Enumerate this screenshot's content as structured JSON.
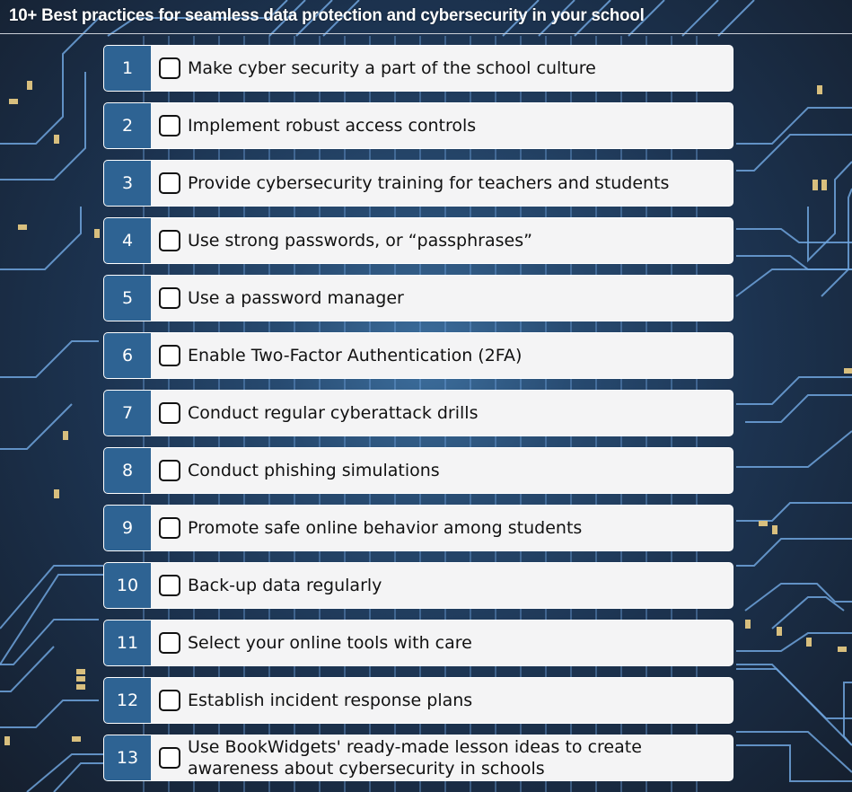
{
  "header": {
    "title": "10+ Best practices for seamless data protection and cybersecurity in your school"
  },
  "theme": {
    "number_badge_color": "#2e6393",
    "item_background": "#f4f4f5",
    "circuit_line_color": "#6fa3dc",
    "circuit_pad_color": "#d8bf7e"
  },
  "checklist": {
    "items": [
      {
        "number": "1",
        "label": "Make cyber security a part of the school culture",
        "checked": false
      },
      {
        "number": "2",
        "label": "Implement robust access controls",
        "checked": false
      },
      {
        "number": "3",
        "label": "Provide cybersecurity training for teachers and students",
        "checked": false
      },
      {
        "number": "4",
        "label": "Use strong passwords, or “passphrases”",
        "checked": false
      },
      {
        "number": "5",
        "label": "Use a password manager",
        "checked": false
      },
      {
        "number": "6",
        "label": "Enable Two-Factor Authentication (2FA)",
        "checked": false
      },
      {
        "number": "7",
        "label": "Conduct regular cyberattack drills",
        "checked": false
      },
      {
        "number": "8",
        "label": "Conduct phishing simulations",
        "checked": false
      },
      {
        "number": "9",
        "label": "Promote safe online behavior among students",
        "checked": false
      },
      {
        "number": "10",
        "label": "Back-up data regularly",
        "checked": false
      },
      {
        "number": "11",
        "label": "Select your online tools with care",
        "checked": false
      },
      {
        "number": "12",
        "label": "Establish incident response plans",
        "checked": false
      },
      {
        "number": "13",
        "label": "Use BookWidgets' ready-made lesson ideas to create awareness about cybersecurity in schools",
        "checked": false
      }
    ]
  }
}
